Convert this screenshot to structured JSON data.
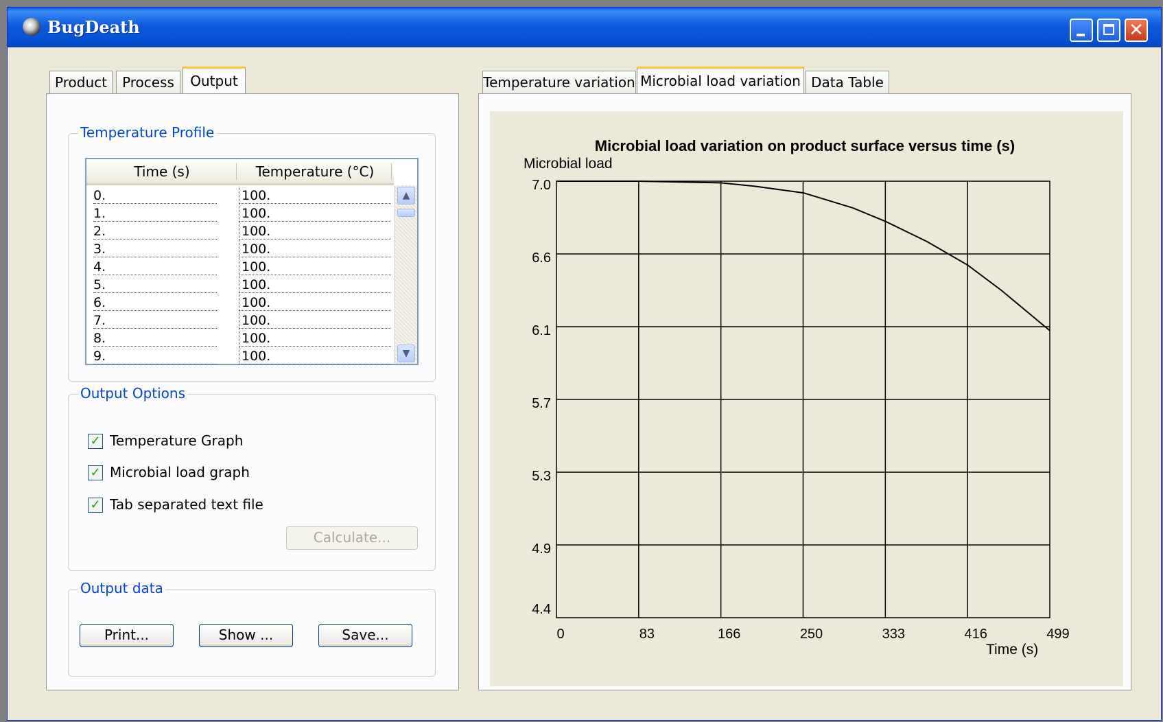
{
  "window": {
    "title": "BugDeath"
  },
  "left_tabs": [
    "Product",
    "Process",
    "Output"
  ],
  "right_tabs": [
    "Temperature variation",
    "Microbial load variation",
    "Data Table"
  ],
  "temperature_profile": {
    "group_label": "Temperature Profile",
    "columns": [
      "Time (s)",
      "Temperature (°C)"
    ],
    "rows": [
      [
        "0.",
        "100."
      ],
      [
        "1.",
        "100."
      ],
      [
        "2.",
        "100."
      ],
      [
        "3.",
        "100."
      ],
      [
        "4.",
        "100."
      ],
      [
        "5.",
        "100."
      ],
      [
        "6.",
        "100."
      ],
      [
        "7.",
        "100."
      ],
      [
        "8.",
        "100."
      ],
      [
        "9.",
        "100."
      ]
    ]
  },
  "output_options": {
    "group_label": "Output Options",
    "checkboxes": [
      {
        "label": "Temperature Graph",
        "checked": true
      },
      {
        "label": "Microbial load graph",
        "checked": true
      },
      {
        "label": "Tab separated text file",
        "checked": true
      }
    ],
    "calculate_label": "Calculate..."
  },
  "output_data": {
    "group_label": "Output data",
    "print_label": "Print...",
    "show_label": "Show ...",
    "save_label": "Save..."
  },
  "chart_data": {
    "type": "line",
    "title": "Microbial load variation on product surface versus time (s)",
    "xlabel": "Time (s)",
    "ylabel": "Microbial load",
    "xlim": [
      0,
      499
    ],
    "ylim": [
      4.4,
      7.0
    ],
    "x_ticks": [
      "0",
      "83",
      "166",
      "250",
      "333",
      "416",
      "499"
    ],
    "y_ticks": [
      "7.0",
      "6.6",
      "6.1",
      "5.7",
      "5.3",
      "4.9",
      "4.4"
    ],
    "grid": true,
    "series": [
      {
        "color": "#000000",
        "x": [
          0,
          83,
          166,
          200,
          250,
          300,
          333,
          375,
          416,
          450,
          499
        ],
        "y": [
          7.0,
          7.0,
          6.99,
          6.97,
          6.93,
          6.84,
          6.76,
          6.64,
          6.5,
          6.35,
          6.11
        ]
      }
    ]
  }
}
